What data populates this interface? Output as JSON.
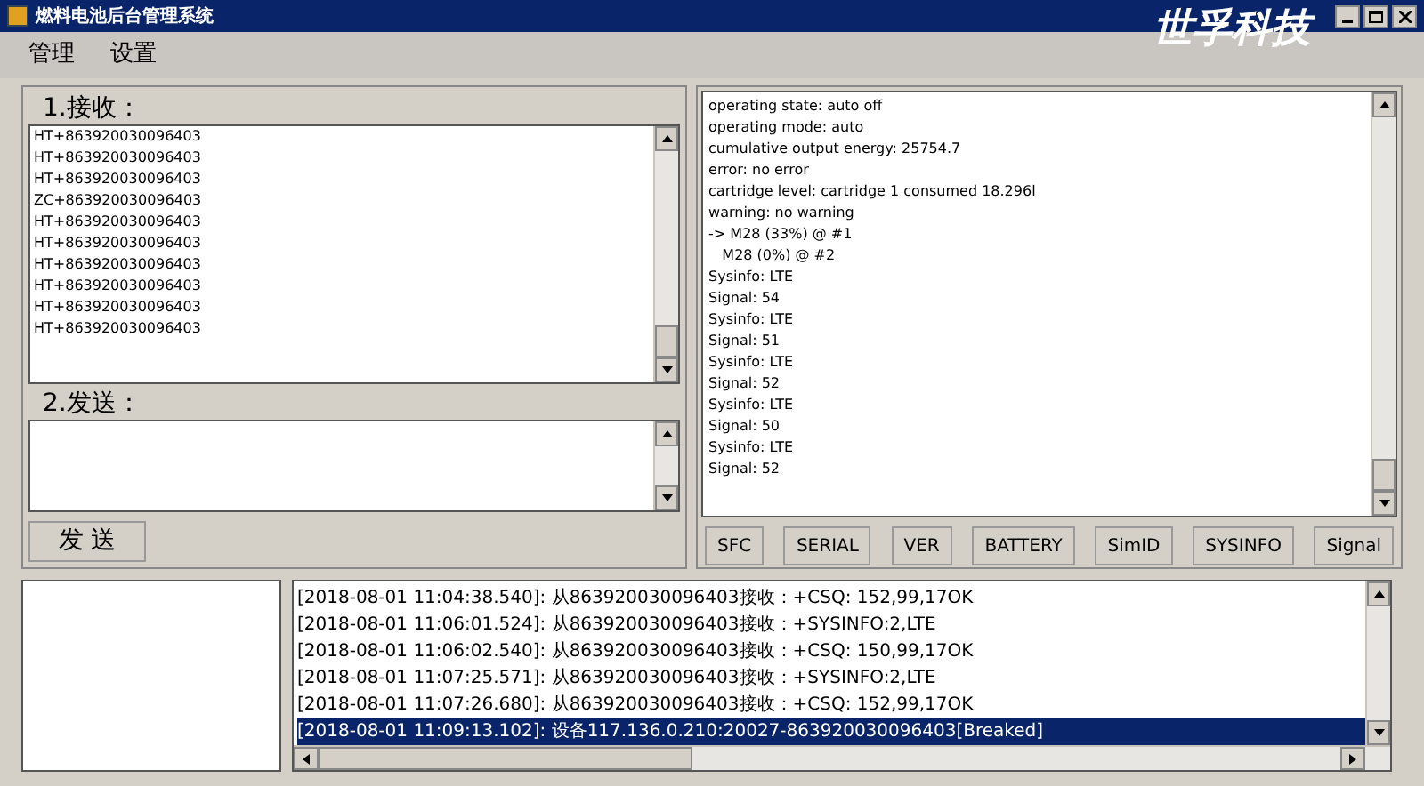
{
  "window": {
    "title": "燃料电池后台管理系统",
    "logo": "世孚科技"
  },
  "menu": [
    "管理",
    "设置"
  ],
  "receive": {
    "label": "1.接收：",
    "lines": [
      "HT+863920030096403",
      "HT+863920030096403",
      "HT+863920030096403",
      "ZC+863920030096403",
      "HT+863920030096403",
      "HT+863920030096403",
      "HT+863920030096403",
      "HT+863920030096403",
      "HT+863920030096403",
      "HT+863920030096403"
    ]
  },
  "send": {
    "label": "2.发送：",
    "button": "发 送"
  },
  "output": {
    "lines": [
      "operating state: auto off",
      "operating mode: auto",
      "cumulative output energy: 25754.7",
      "error: no error",
      "cartridge level: cartridge 1 consumed 18.296l",
      "warning: no warning",
      "-> M28 (33%) @ #1",
      "   M28 (0%) @ #2",
      "Sysinfo: LTE",
      "Signal: 54",
      "Sysinfo: LTE",
      "Signal: 51",
      "Sysinfo: LTE",
      "Signal: 52",
      "Sysinfo: LTE",
      "Signal: 50",
      "Sysinfo: LTE",
      "Signal: 52"
    ],
    "buttons": [
      "SFC",
      "SERIAL",
      "VER",
      "BATTERY",
      "SimID",
      "SYSINFO",
      "Signal"
    ]
  },
  "log": [
    {
      "text": "[2018-08-01 11:04:38.540]: 从863920030096403接收：+CSQ: 152,99,17OK",
      "selected": false
    },
    {
      "text": "[2018-08-01 11:06:01.524]: 从863920030096403接收：+SYSINFO:2,LTE",
      "selected": false
    },
    {
      "text": "[2018-08-01 11:06:02.540]: 从863920030096403接收：+CSQ: 150,99,17OK",
      "selected": false
    },
    {
      "text": "[2018-08-01 11:07:25.571]: 从863920030096403接收：+SYSINFO:2,LTE",
      "selected": false
    },
    {
      "text": "[2018-08-01 11:07:26.680]: 从863920030096403接收：+CSQ: 152,99,17OK",
      "selected": false
    },
    {
      "text": "[2018-08-01 11:09:13.102]: 设备117.136.0.210:20027-863920030096403[Breaked]",
      "selected": true
    }
  ]
}
